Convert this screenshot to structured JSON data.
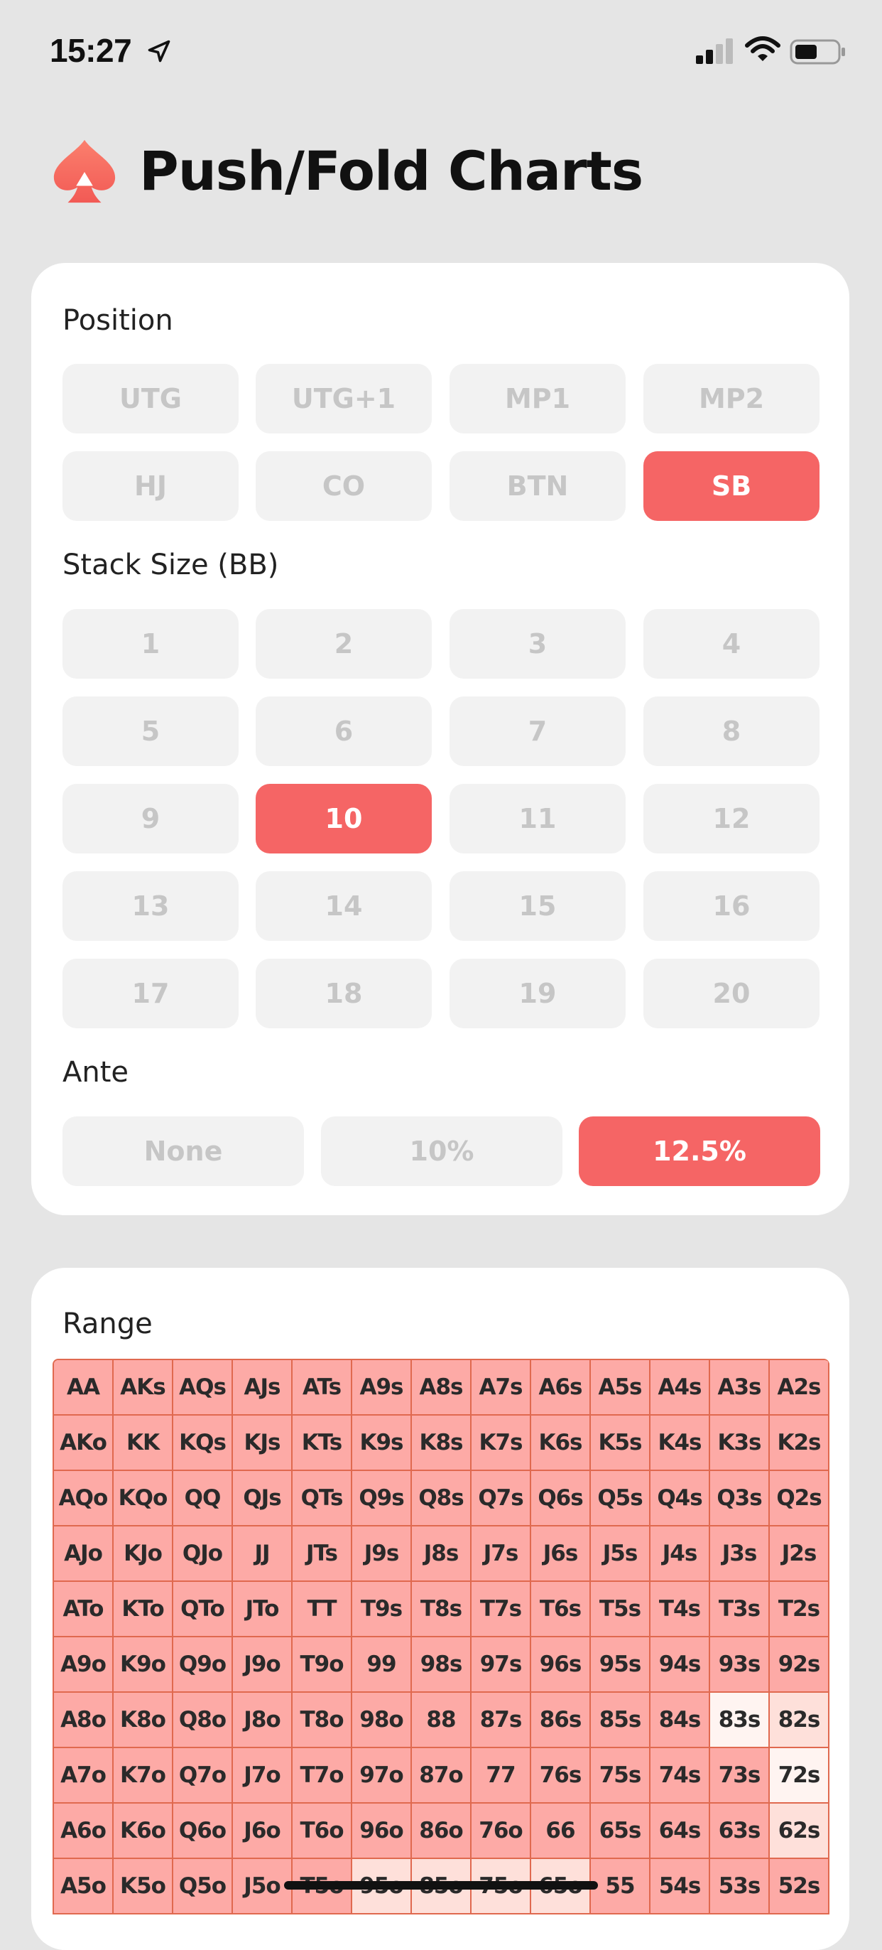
{
  "status_bar": {
    "time": "15:27"
  },
  "header": {
    "title": "Push/Fold Charts"
  },
  "position": {
    "label": "Position",
    "options": [
      "UTG",
      "UTG+1",
      "MP1",
      "MP2",
      "HJ",
      "CO",
      "BTN",
      "SB"
    ],
    "selected": "SB"
  },
  "stack": {
    "label": "Stack Size (BB)",
    "options": [
      "1",
      "2",
      "3",
      "4",
      "5",
      "6",
      "7",
      "8",
      "9",
      "10",
      "11",
      "12",
      "13",
      "14",
      "15",
      "16",
      "17",
      "18",
      "19",
      "20"
    ],
    "selected": "10"
  },
  "ante": {
    "label": "Ante",
    "options": [
      "None",
      "10%",
      "12.5%"
    ],
    "selected": "12.5%"
  },
  "range": {
    "label": "Range",
    "rows": [
      [
        "AA",
        "AKs",
        "AQs",
        "AJs",
        "ATs",
        "A9s",
        "A8s",
        "A7s",
        "A6s",
        "A5s",
        "A4s",
        "A3s",
        "A2s"
      ],
      [
        "AKo",
        "KK",
        "KQs",
        "KJs",
        "KTs",
        "K9s",
        "K8s",
        "K7s",
        "K6s",
        "K5s",
        "K4s",
        "K3s",
        "K2s"
      ],
      [
        "AQo",
        "KQo",
        "QQ",
        "QJs",
        "QTs",
        "Q9s",
        "Q8s",
        "Q7s",
        "Q6s",
        "Q5s",
        "Q4s",
        "Q3s",
        "Q2s"
      ],
      [
        "AJo",
        "KJo",
        "QJo",
        "JJ",
        "JTs",
        "J9s",
        "J8s",
        "J7s",
        "J6s",
        "J5s",
        "J4s",
        "J3s",
        "J2s"
      ],
      [
        "ATo",
        "KTo",
        "QTo",
        "JTo",
        "TT",
        "T9s",
        "T8s",
        "T7s",
        "T6s",
        "T5s",
        "T4s",
        "T3s",
        "T2s"
      ],
      [
        "A9o",
        "K9o",
        "Q9o",
        "J9o",
        "T9o",
        "99",
        "98s",
        "97s",
        "96s",
        "95s",
        "94s",
        "93s",
        "92s"
      ],
      [
        "A8o",
        "K8o",
        "Q8o",
        "J8o",
        "T8o",
        "98o",
        "88",
        "87s",
        "86s",
        "85s",
        "84s",
        "83s",
        "82s"
      ],
      [
        "A7o",
        "K7o",
        "Q7o",
        "J7o",
        "T7o",
        "97o",
        "87o",
        "77",
        "76s",
        "75s",
        "74s",
        "73s",
        "72s"
      ],
      [
        "A6o",
        "K6o",
        "Q6o",
        "J6o",
        "T6o",
        "96o",
        "86o",
        "76o",
        "66",
        "65s",
        "64s",
        "63s",
        "62s"
      ],
      [
        "A5o",
        "K5o",
        "Q5o",
        "J5o",
        "T5o",
        "95o",
        "85o",
        "75o",
        "65o",
        "55",
        "54s",
        "53s",
        "52s"
      ]
    ],
    "states": [
      [
        "push",
        "push",
        "push",
        "push",
        "push",
        "push",
        "push",
        "push",
        "push",
        "push",
        "push",
        "push",
        "push"
      ],
      [
        "push",
        "push",
        "push",
        "push",
        "push",
        "push",
        "push",
        "push",
        "push",
        "push",
        "push",
        "push",
        "push"
      ],
      [
        "push",
        "push",
        "push",
        "push",
        "push",
        "push",
        "push",
        "push",
        "push",
        "push",
        "push",
        "push",
        "push"
      ],
      [
        "push",
        "push",
        "push",
        "push",
        "push",
        "push",
        "push",
        "push",
        "push",
        "push",
        "push",
        "push",
        "push"
      ],
      [
        "push",
        "push",
        "push",
        "push",
        "push",
        "push",
        "push",
        "push",
        "push",
        "push",
        "push",
        "push",
        "push"
      ],
      [
        "push",
        "push",
        "push",
        "push",
        "push",
        "push",
        "push",
        "push",
        "push",
        "push",
        "push",
        "push",
        "push"
      ],
      [
        "push",
        "push",
        "push",
        "push",
        "push",
        "push",
        "push",
        "push",
        "push",
        "push",
        "push",
        "fold",
        "mixed"
      ],
      [
        "push",
        "push",
        "push",
        "push",
        "push",
        "push",
        "push",
        "push",
        "push",
        "push",
        "push",
        "push",
        "fold"
      ],
      [
        "push",
        "push",
        "push",
        "push",
        "push",
        "push",
        "push",
        "push",
        "push",
        "push",
        "push",
        "push",
        "mixed"
      ],
      [
        "push",
        "push",
        "push",
        "push",
        "push",
        "mixed",
        "mixed",
        "mixed",
        "mixed",
        "push",
        "push",
        "push",
        "push"
      ]
    ]
  },
  "colors": {
    "accent": "#f56565",
    "push_cell": "#fdaaa6",
    "mixed_cell": "#fee0da",
    "fold_cell": "#fff4f1",
    "grid_line": "#e0694f"
  }
}
